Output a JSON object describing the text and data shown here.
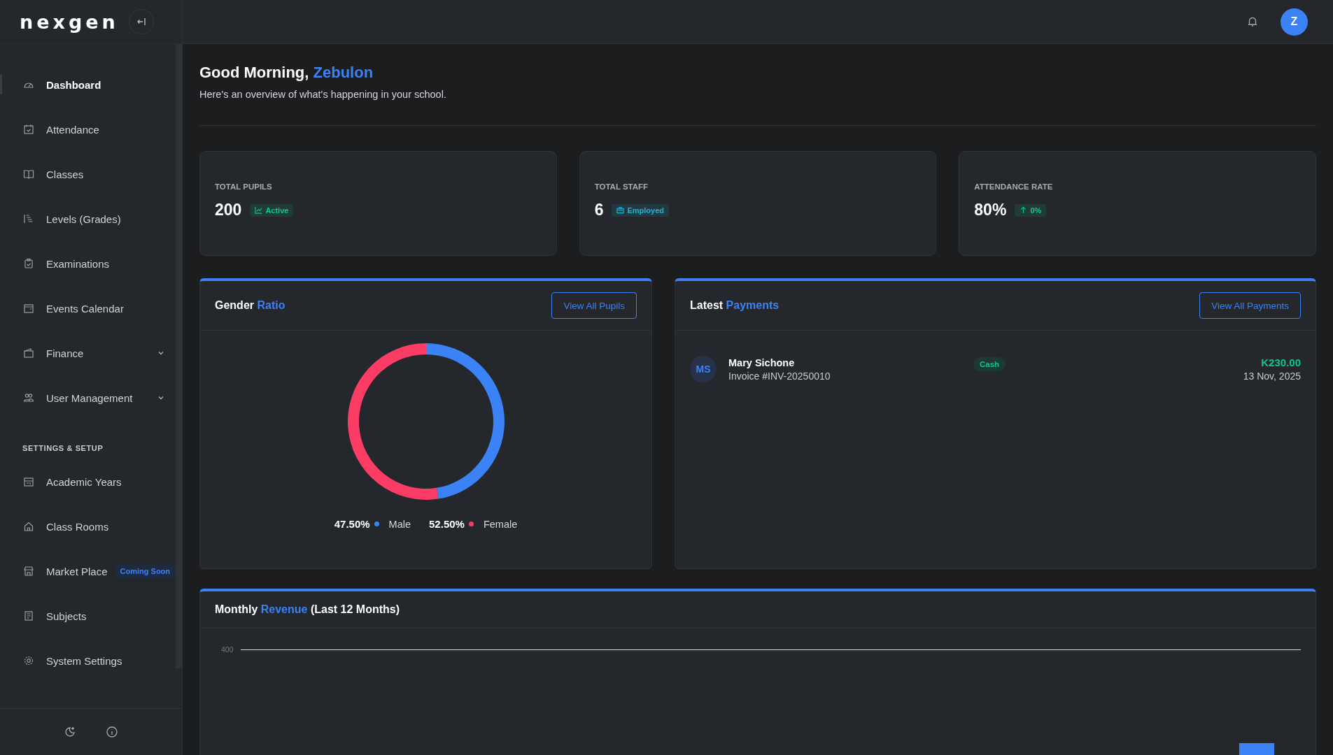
{
  "brand": {
    "logo": "nexgen"
  },
  "topbar": {
    "avatar_initial": "Z"
  },
  "sidebar": {
    "items": [
      {
        "label": "Dashboard",
        "selected": true,
        "has_submenu": false
      },
      {
        "label": "Attendance",
        "selected": false,
        "has_submenu": false
      },
      {
        "label": "Classes",
        "selected": false,
        "has_submenu": false
      },
      {
        "label": "Levels (Grades)",
        "selected": false,
        "has_submenu": false
      },
      {
        "label": "Examinations",
        "selected": false,
        "has_submenu": false
      },
      {
        "label": "Events Calendar",
        "selected": false,
        "has_submenu": false
      },
      {
        "label": "Finance",
        "selected": false,
        "has_submenu": true
      },
      {
        "label": "User Management",
        "selected": false,
        "has_submenu": true
      }
    ],
    "section_title": "SETTINGS & SETUP",
    "settings_items": [
      {
        "label": "Academic Years",
        "selected": false
      },
      {
        "label": "Class Rooms",
        "selected": false
      },
      {
        "label": "Market Place",
        "selected": false,
        "badge": "Coming Soon"
      },
      {
        "label": "Subjects",
        "selected": false
      },
      {
        "label": "System Settings",
        "selected": false
      }
    ]
  },
  "greeting": {
    "lead": "Good Morning,",
    "accent": "Zebulon",
    "subtitle": "Here's an overview of what's happening in your school."
  },
  "stats": [
    {
      "label": "TOTAL PUPILS",
      "value": "200",
      "badge": "Active",
      "color": "#10c88a"
    },
    {
      "label": "TOTAL STAFF",
      "value": "6",
      "badge": "Employed",
      "color": "#1fb5d4"
    },
    {
      "label": "ATTENDANCE RATE",
      "value": "80%",
      "badge": "0%",
      "color": "#10c88a"
    }
  ],
  "gender_panel": {
    "title": {
      "lead": "Gender",
      "accent": "Ratio"
    },
    "button": "View All Pupils",
    "chart_data": {
      "type": "donut",
      "categories": [
        "Male",
        "Female"
      ],
      "values": [
        47.5,
        52.5
      ]
    },
    "legend": [
      {
        "value": "47.50%",
        "color": "#3b82f6"
      },
      {
        "value": "52.50%",
        "color": "#fb3c64"
      }
    ]
  },
  "payments_panel": {
    "title": {
      "lead": "Latest",
      "accent": "Payments"
    },
    "button": "View All Payments",
    "rows": [
      {
        "initials": "MS",
        "name": "Mary Sichone",
        "invoice": "Invoice #INV-20250010",
        "method": "Cash",
        "amount": "K230.00",
        "date": "13 Nov, 2025"
      }
    ]
  },
  "revenue_panel": {
    "title": {
      "lead": "Monthly",
      "accent": "Revenue",
      "tail": "(Last 12 Months)"
    },
    "tick_label": "400"
  }
}
